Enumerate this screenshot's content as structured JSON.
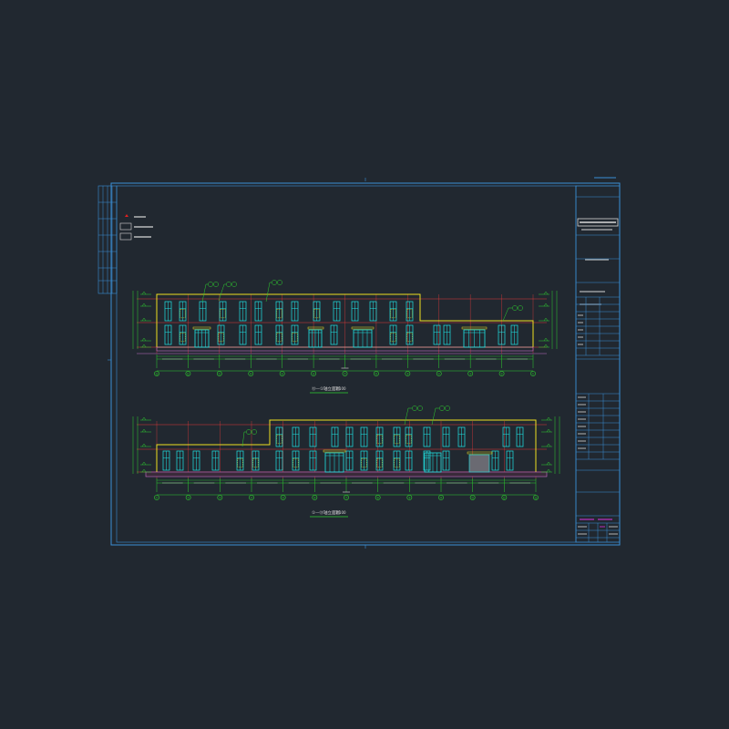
{
  "drawing": {
    "background": "#212830",
    "colors": {
      "frame": "#3a8fd6",
      "outline": "#f0e020",
      "window": "#21e6e6",
      "grid": "#2fd12f",
      "level": "#e23a3a",
      "base": "#c86ec8",
      "text": "#d8d8d8",
      "note": "#e030e0",
      "symbol": "#e02020"
    },
    "elevations": [
      {
        "title": "⑬—①轴立面图",
        "scale": "1:100",
        "axes": [
          "⑬",
          "⑫",
          "⑪",
          "⑩",
          "⑨",
          "⑧",
          "⑦",
          "⑥",
          "⑤",
          "④",
          "③",
          "②",
          "①"
        ]
      },
      {
        "title": "①—⑬轴立面图",
        "scale": "1:100",
        "axes": [
          "①",
          "②",
          "③",
          "④",
          "⑤",
          "⑥",
          "⑦",
          "⑧",
          "⑨",
          "⑩",
          "⑪",
          "⑫",
          "⑬"
        ]
      }
    ]
  }
}
